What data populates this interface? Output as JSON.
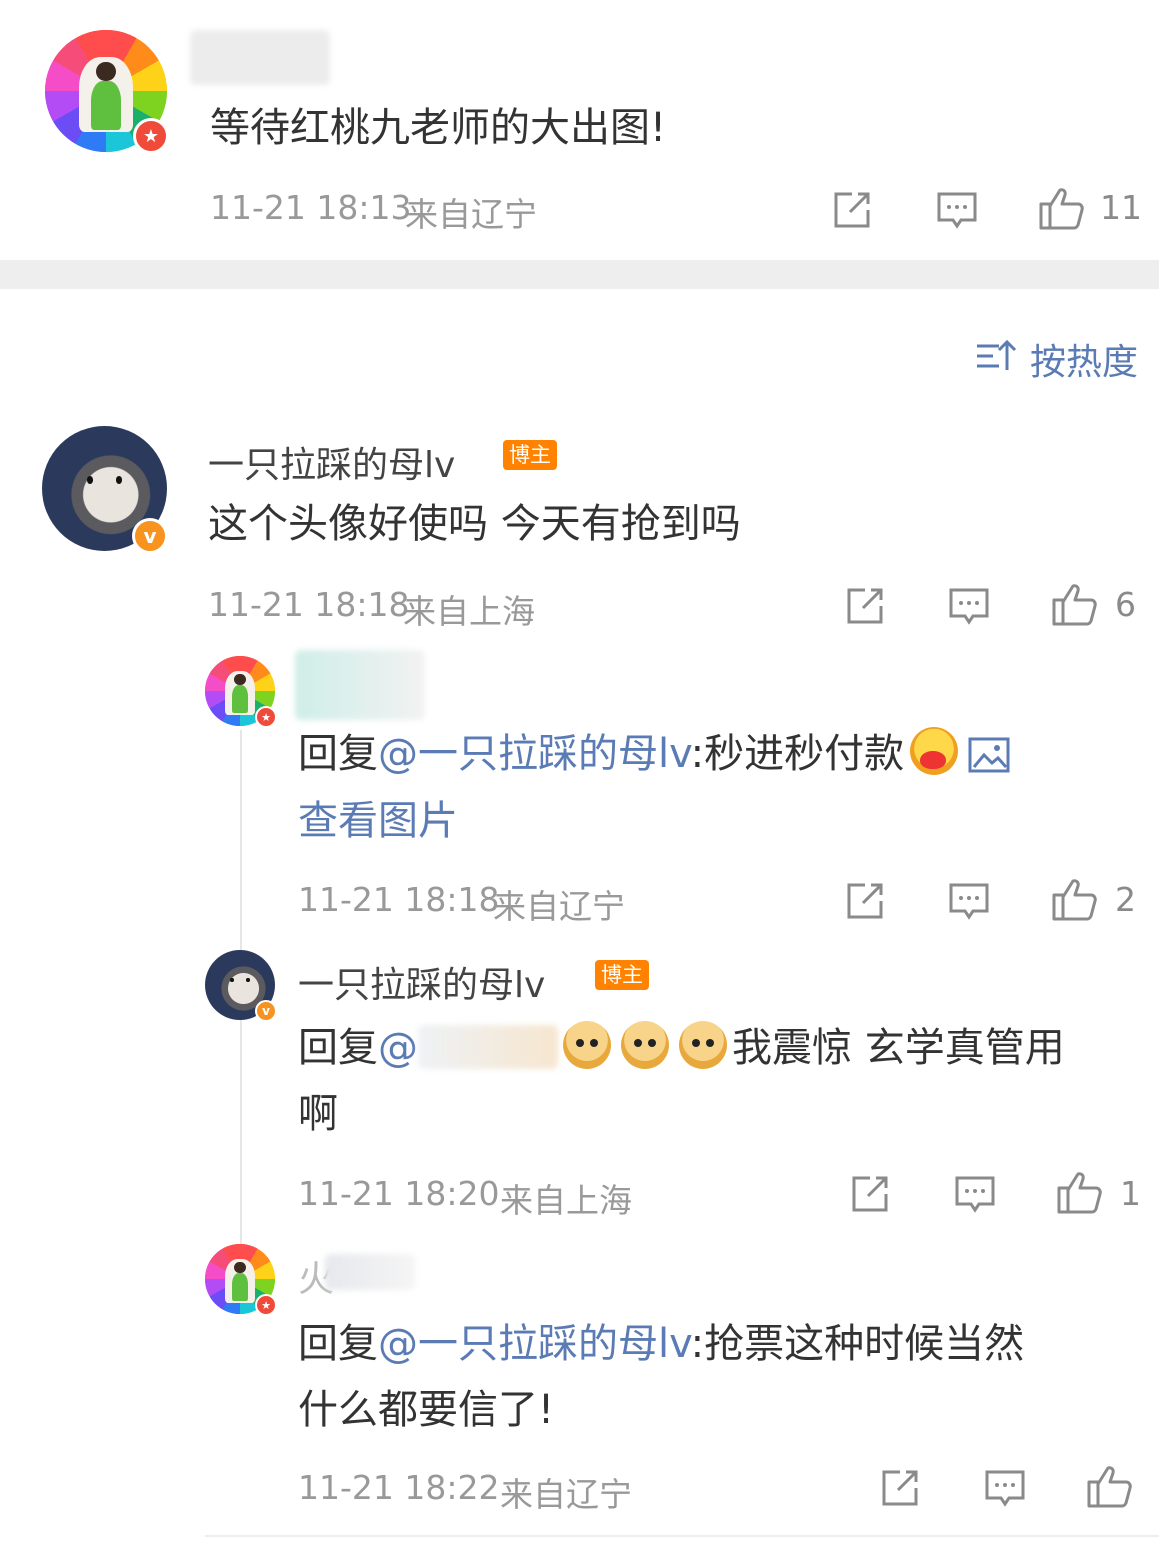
{
  "comment1": {
    "text": "等待红桃九老师的大出图!",
    "time": "11-21 18:13",
    "location": "来自辽宁",
    "likes": "11"
  },
  "sort": {
    "label": "按热度"
  },
  "comment2": {
    "username": "一只拉踩的母lv",
    "tag": "博主",
    "text": "这个头像好使吗 今天有抢到吗",
    "time": "11-21 18:18",
    "location": "来自上海",
    "likes": "6"
  },
  "reply1": {
    "prefix": "回复",
    "mention": "@一只拉踩的母lv",
    "text": ":秒进秒付款",
    "view_image": "查看图片",
    "time": "11-21 18:18",
    "location": "来自辽宁",
    "likes": "2"
  },
  "reply2": {
    "username": "一只拉踩的母lv",
    "tag": "博主",
    "prefix": "回复",
    "mention_visible": "@",
    "text": "我震惊 玄学真管用",
    "text2": "啊",
    "time": "11-21 18:20",
    "location": "来自上海",
    "likes": "1"
  },
  "reply3": {
    "username_visible": "火",
    "prefix": "回复",
    "mention": "@一只拉踩的母lv",
    "text": ":抢票这种时候当然",
    "text2": "什么都要信了!",
    "time": "11-21 18:22",
    "location": "来自辽宁"
  },
  "icons": {
    "share": "share-icon",
    "comment": "comment-icon",
    "like": "like-icon",
    "sort": "sort-icon",
    "image": "image-icon"
  },
  "colors": {
    "link": "#5b7bb4",
    "tag": "#ff8200",
    "verified": "#f7931e",
    "star_badge": "#f04b3a"
  }
}
